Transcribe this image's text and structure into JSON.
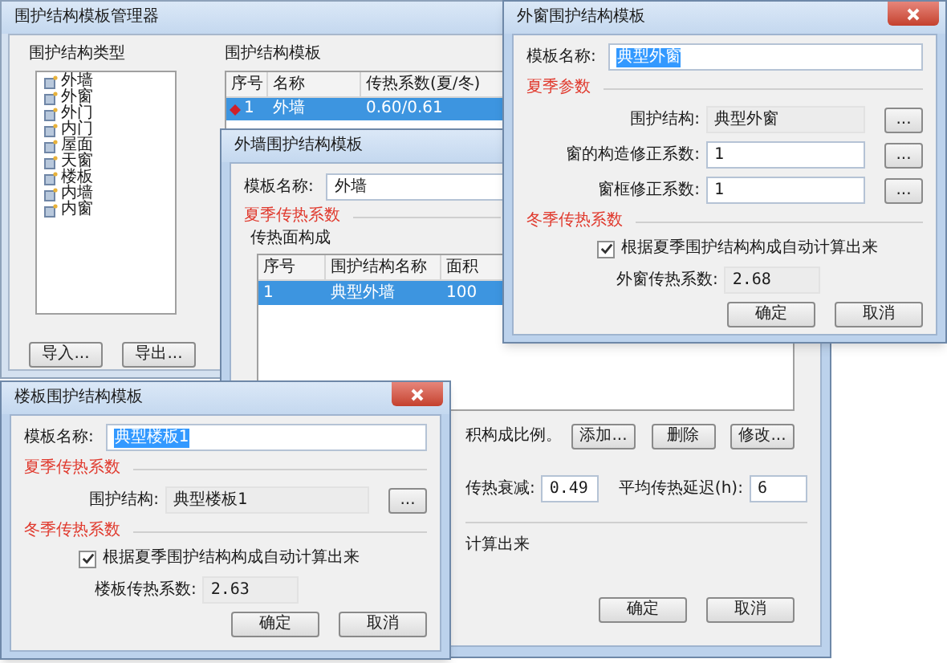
{
  "manager": {
    "title": "围护结构模板管理器",
    "types_label": "围护结构类型",
    "types": [
      {
        "label": "外墙"
      },
      {
        "label": "外窗"
      },
      {
        "label": "外门"
      },
      {
        "label": "内门"
      },
      {
        "label": "屋面"
      },
      {
        "label": "天窗"
      },
      {
        "label": "楼板"
      },
      {
        "label": "内墙"
      },
      {
        "label": "内窗"
      }
    ],
    "import_button": "导入...",
    "export_button": "导出...",
    "templates_label": "围护结构模板",
    "columns": [
      "序号",
      "名称",
      "传热系数(夏/冬)"
    ],
    "rows": [
      {
        "index": "1",
        "name": "外墙",
        "u_value": "0.60/0.61",
        "selected": true
      }
    ]
  },
  "outer_wall_dialog": {
    "title": "外墙围护结构模板",
    "name_label": "模板名称:",
    "name_value": "外墙",
    "summer_label": "夏季传热系数",
    "group_label": "传热面构成",
    "columns": [
      "序号",
      "围护结构名称",
      "面积"
    ],
    "rows": [
      {
        "index": "1",
        "name": "典型外墙",
        "area": "100",
        "selected": true
      }
    ],
    "ratio_note": "积构成比例。",
    "buttons": [
      "添加...",
      "删除",
      "修改..."
    ],
    "attenuation_label": "传热衰减:",
    "attenuation_value": "0.49",
    "delay_label": "平均传热延迟(h):",
    "delay_value": "6",
    "auto_note": "计算出来",
    "ok": "确定",
    "cancel": "取消"
  },
  "outer_window_dialog": {
    "title": "外窗围护结构模板",
    "name_label": "模板名称:",
    "name_value": "典型外窗",
    "summer_label": "夏季参数",
    "fields": [
      {
        "label": "围护结构:",
        "value": "典型外窗",
        "readonly": true,
        "browse": "..."
      },
      {
        "label": "窗的构造修正系数:",
        "value": "1",
        "readonly": false,
        "browse": "..."
      },
      {
        "label": "窗框修正系数:",
        "value": "1",
        "readonly": false,
        "browse": "..."
      }
    ],
    "winter_label": "冬季传热系数",
    "auto_checkbox": {
      "label": "根据夏季围护结构构成自动计算出来",
      "checked": true
    },
    "result_label": "外窗传热系数:",
    "result_value": "2.68",
    "ok": "确定",
    "cancel": "取消"
  },
  "floor_dialog": {
    "title": "楼板围护结构模板",
    "name_label": "模板名称:",
    "name_value": "典型楼板1",
    "summer_label": "夏季传热系数",
    "fields": [
      {
        "label": "围护结构:",
        "value": "典型楼板1",
        "readonly": true,
        "browse": "..."
      }
    ],
    "winter_label": "冬季传热系数",
    "auto_checkbox": {
      "label": "根据夏季围护结构构成自动计算出来",
      "checked": true
    },
    "result_label": "楼板传热系数:",
    "result_value": "2.63",
    "ok": "确定",
    "cancel": "取消"
  }
}
